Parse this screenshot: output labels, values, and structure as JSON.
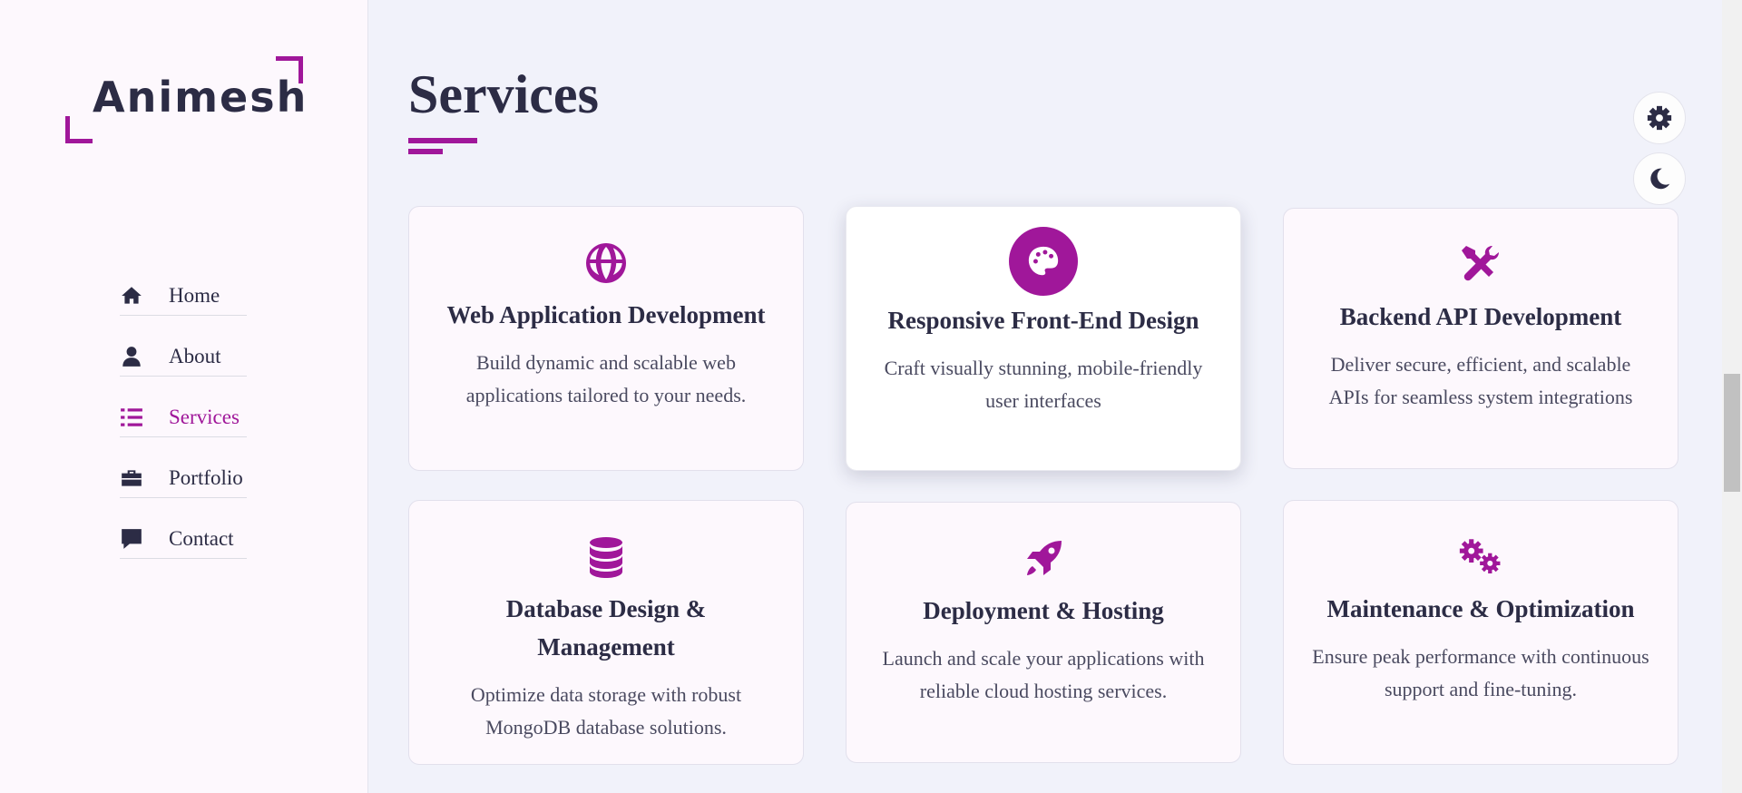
{
  "logo": {
    "text": "Animesh"
  },
  "nav": {
    "items": [
      {
        "label": "Home",
        "icon": "home-icon",
        "active": false
      },
      {
        "label": "About",
        "icon": "user-icon",
        "active": false
      },
      {
        "label": "Services",
        "icon": "list-icon",
        "active": true
      },
      {
        "label": "Portfolio",
        "icon": "briefcase-icon",
        "active": false
      },
      {
        "label": "Contact",
        "icon": "chat-icon",
        "active": false
      }
    ]
  },
  "main": {
    "title": "Services",
    "cards": [
      {
        "title": "Web Application Development",
        "desc": "Build dynamic and scalable web applications tailored to your needs.",
        "icon": "globe-icon"
      },
      {
        "title": "Responsive Front-End Design",
        "desc": "Craft visually stunning, mobile-friendly user interfaces",
        "icon": "palette-icon"
      },
      {
        "title": "Backend API Development",
        "desc": "Deliver secure, efficient, and scalable APIs for seamless system integrations",
        "icon": "tools-icon"
      },
      {
        "title": "Database Design & Management",
        "desc": "Optimize data storage with robust MongoDB database solutions.",
        "icon": "database-icon"
      },
      {
        "title": "Deployment & Hosting",
        "desc": "Launch and scale your applications with reliable cloud hosting services.",
        "icon": "rocket-icon"
      },
      {
        "title": "Maintenance & Optimization",
        "desc": "Ensure peak performance with continuous support and fine-tuning.",
        "icon": "gears-icon"
      }
    ]
  },
  "floating": {
    "settings_icon": "gear-icon",
    "theme_icon": "moon-icon"
  },
  "colors": {
    "accent": "#a0179a",
    "text": "#2c2c45",
    "background": "#f1f2fa",
    "sidebar": "#fdf8fd"
  }
}
